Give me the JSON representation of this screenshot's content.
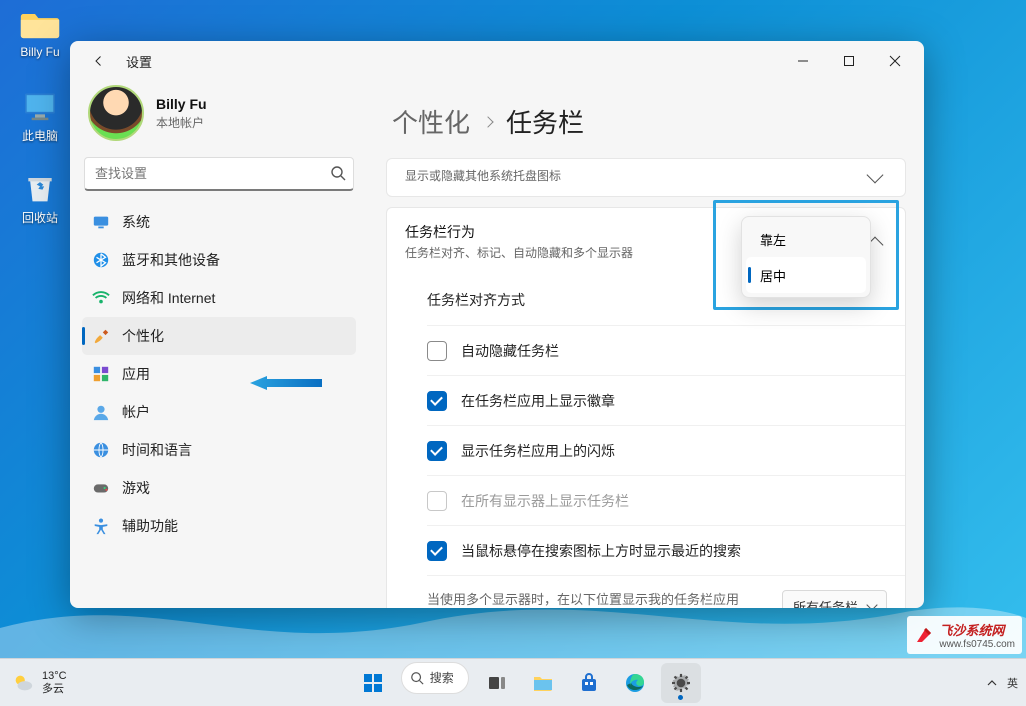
{
  "desktop": {
    "folder": "Billy Fu",
    "pc": "此电脑",
    "recycle": "回收站"
  },
  "settings": {
    "title": "设置",
    "user": {
      "name": "Billy Fu",
      "sub": "本地帐户"
    },
    "search_placeholder": "查找设置",
    "nav": {
      "system": "系统",
      "bluetooth": "蓝牙和其他设备",
      "network": "网络和 Internet",
      "personalization": "个性化",
      "apps": "应用",
      "accounts": "帐户",
      "time": "时间和语言",
      "gaming": "游戏",
      "accessibility": "辅助功能"
    },
    "breadcrumb": {
      "parent": "个性化",
      "current": "任务栏"
    },
    "tray_sub": "显示或隐藏其他系统托盘图标",
    "behavior": {
      "title": "任务栏行为",
      "sub": "任务栏对齐、标记、自动隐藏和多个显示器",
      "alignment_label": "任务栏对齐方式",
      "alignment_options": {
        "left": "靠左",
        "center": "居中"
      },
      "auto_hide": "自动隐藏任务栏",
      "badges": "在任务栏应用上显示徽章",
      "flash": "显示任务栏应用上的闪烁",
      "all_displays": "在所有显示器上显示任务栏",
      "multi_label": "当使用多个显示器时，在以下位置显示我的任务栏应用",
      "multi_value": "所有任务栏",
      "search_hover": "当鼠标悬停在搜索图标上方时显示最近的搜索"
    }
  },
  "taskbar": {
    "weather_temp": "13°C",
    "weather_desc": "多云",
    "search": "搜索",
    "ime": "英"
  },
  "watermark": {
    "name": "飞沙系统网",
    "url": "www.fs0745.com"
  }
}
